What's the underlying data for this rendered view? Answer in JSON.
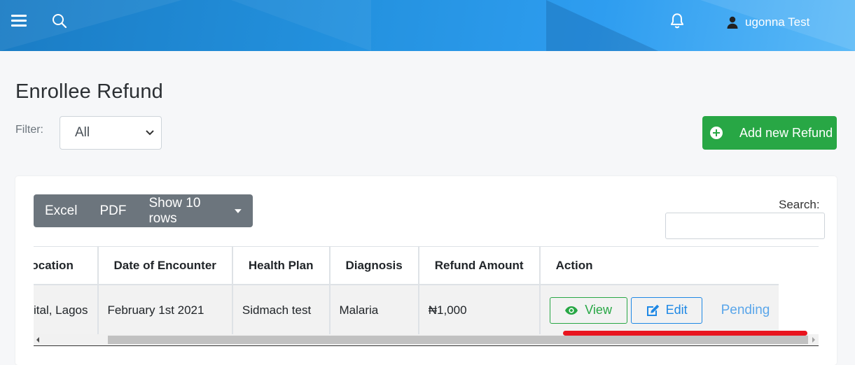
{
  "header": {
    "user_name": "ugonna Test",
    "menu_icon": "hamburger-menu-icon",
    "search_icon": "search-icon",
    "notification_icon": "bell-icon",
    "user_icon": "user-icon"
  },
  "page": {
    "title": "Enrollee Refund",
    "filter_label": "Filter:",
    "filter_value": "All",
    "add_button_label": "Add new Refund"
  },
  "toolbar": {
    "excel_label": "Excel",
    "pdf_label": "PDF",
    "rows_label": "Show 10 rows"
  },
  "search": {
    "label": "Search:",
    "value": ""
  },
  "table": {
    "headers": [
      "Location",
      "Date of Encounter",
      "Health Plan",
      "Diagnosis",
      "Refund Amount",
      "Action"
    ],
    "rows": [
      {
        "location": "ital, Lagos",
        "date": "February 1st 2021",
        "plan": "Sidmach test",
        "diagnosis": "Malaria",
        "amount": "₦1,000",
        "view_label": "View",
        "edit_label": "Edit",
        "status": "Pending"
      }
    ]
  },
  "colors": {
    "header_blue": "#2391de",
    "success": "#28a745",
    "primary": "#1e88e5",
    "status_pending": "#5aa6ea",
    "annotation": "#e8141e"
  }
}
